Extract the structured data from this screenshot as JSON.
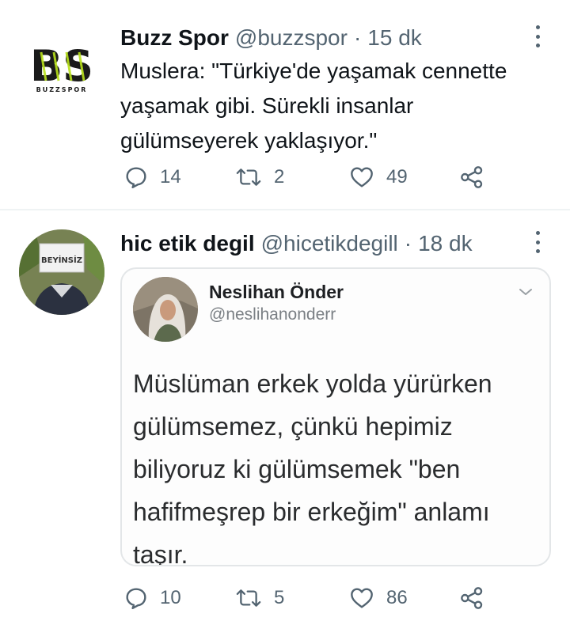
{
  "colors": {
    "text": "#0f1419",
    "secondary": "#536471",
    "divider": "#eff3f4",
    "brand_green": "#b8e21b"
  },
  "tweets": [
    {
      "avatar_icon": "buzzspor-logo",
      "avatar_logo_text": "BS",
      "avatar_logo_subtext": "BUZZSPOR",
      "name": "Buzz Spor",
      "handle": "@buzzspor",
      "separator": "·",
      "time": "15 dk",
      "text": "Muslera: \"Türkiye'de yaşamak cennette yaşamak gibi. Sürekli insanlar gülümseyerek yaklaşıyor.\"",
      "replies": "14",
      "retweets": "2",
      "likes": "49"
    },
    {
      "avatar_icon": "person-with-sign-avatar",
      "avatar_sign_text": "BEYİNSİZ",
      "name": "hic etik degil",
      "handle": "@hicetikdegill",
      "separator": "·",
      "time": "18 dk",
      "replies": "10",
      "retweets": "5",
      "likes": "86",
      "quoted": {
        "name": "Neslihan Önder",
        "handle": "@neslihanonderr",
        "text": "Müslüman erkek yolda yürürken gülümsemez, çünkü hepimiz biliyoruz ki gülümsemek \"ben hafifmeşrep bir erkeğim\" anlamı taşır."
      }
    }
  ]
}
